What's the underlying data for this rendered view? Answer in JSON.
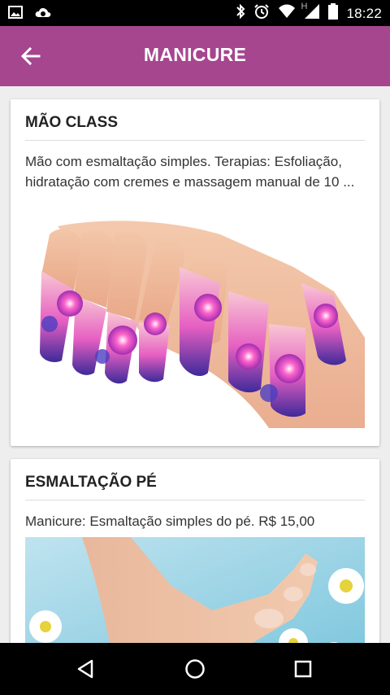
{
  "status_bar": {
    "time": "18:22",
    "network_letter": "H",
    "icons": [
      "image-icon",
      "cloud-sync-icon",
      "bluetooth-icon",
      "alarm-icon",
      "wifi-icon",
      "cell-signal-icon",
      "battery-icon"
    ]
  },
  "app_bar": {
    "title": "MANICURE",
    "back_icon": "arrow-back-icon",
    "background": "#a6468f"
  },
  "services": [
    {
      "title": "MÃO CLASS",
      "description": "Mão com esmaltação simples. Terapias: Esfoliação, hidratação com cremes e massagem manual de 10 ...",
      "image": "nail-art-photo"
    },
    {
      "title": "ESMALTAÇÃO PÉ",
      "description": "Manicure: Esmaltação simples do pé. R$ 15,00",
      "image": "pedicure-photo"
    }
  ],
  "nav_bar": {
    "icons": [
      "nav-back-icon",
      "nav-home-icon",
      "nav-recents-icon"
    ]
  }
}
